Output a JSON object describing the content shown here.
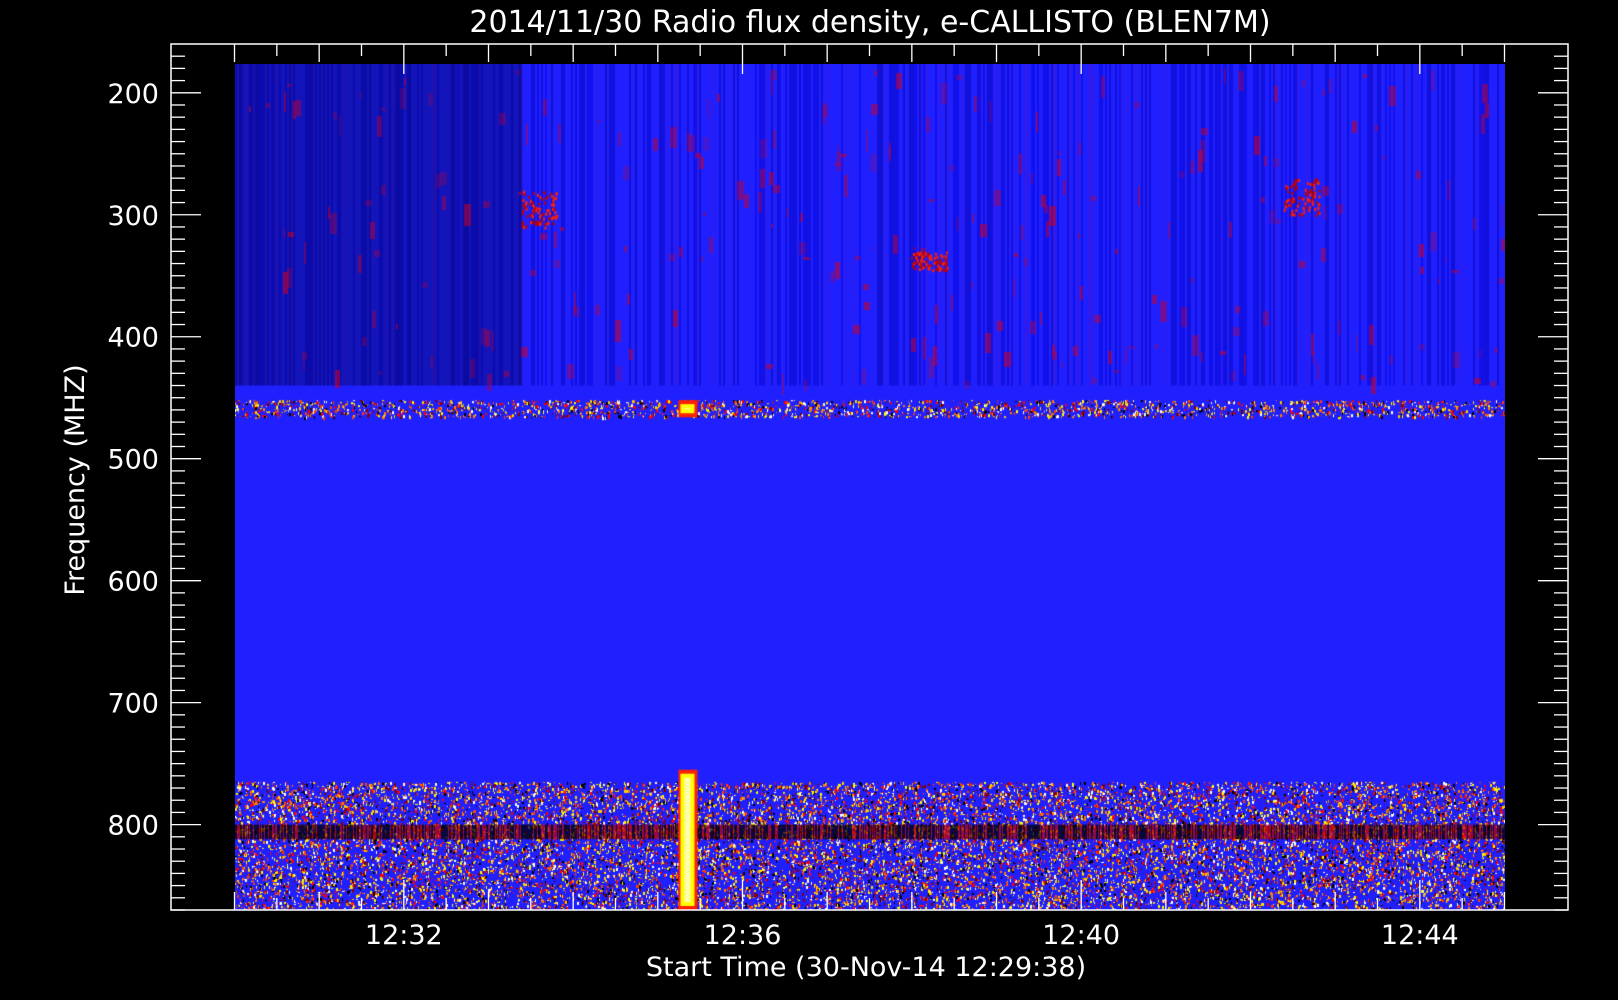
{
  "chart_data": {
    "type": "heatmap",
    "title": "2014/11/30  Radio flux density, e-CALLISTO (BLEN7M)",
    "xlabel": "Start Time (30-Nov-14 12:29:38)",
    "ylabel": "Frequency (MHZ)",
    "x_ticks": [
      {
        "minute": 2,
        "label": "12:32"
      },
      {
        "minute": 6,
        "label": "12:36"
      },
      {
        "minute": 10,
        "label": "12:40"
      },
      {
        "minute": 14,
        "label": "12:44"
      }
    ],
    "y_ticks": [
      200,
      300,
      400,
      500,
      600,
      700,
      800
    ],
    "axis_minutes_range": [
      -0.75,
      15.75
    ],
    "data_minutes_range": [
      0,
      15
    ],
    "ylim": [
      870,
      160
    ],
    "freq_range": [
      870,
      176
    ],
    "colorscale": [
      "#000000",
      "#0000ff",
      "#ff0000",
      "#ffff00",
      "#ffffff"
    ],
    "background_color": "#2020ff",
    "features": [
      {
        "kind": "band",
        "freq": [
          452,
          466
        ],
        "intensity": "speckled red/yellow"
      },
      {
        "kind": "band",
        "freq": [
          765,
          870
        ],
        "intensity": "speckled red/yellow"
      },
      {
        "kind": "band",
        "freq": [
          800,
          812
        ],
        "intensity": "dark"
      },
      {
        "kind": "burst",
        "minute": 5.35,
        "freq": [
          452,
          466
        ],
        "color": "yellow"
      },
      {
        "kind": "burst",
        "minute": 5.35,
        "freq": [
          755,
          870
        ],
        "color": "yellow"
      },
      {
        "kind": "patch",
        "minute": 3.6,
        "freq": [
          280,
          310
        ],
        "color": "red"
      },
      {
        "kind": "patch",
        "minute": 8.2,
        "freq": [
          330,
          345
        ],
        "color": "red"
      },
      {
        "kind": "patch",
        "minute": 12.6,
        "freq": [
          270,
          300
        ],
        "color": "red"
      }
    ]
  }
}
